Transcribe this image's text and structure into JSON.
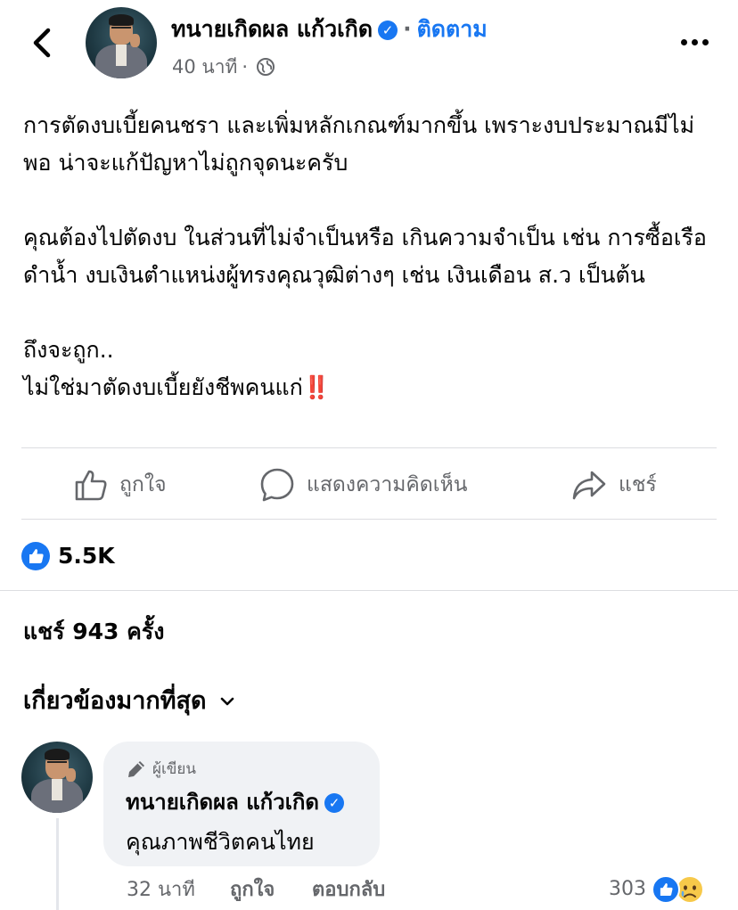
{
  "header": {
    "author_name": "ทนายเกิดผล แก้วเกิด",
    "follow_label": "ติดตาม",
    "time": "40 นาที",
    "separator": "·"
  },
  "post": {
    "paragraph_1": "การตัดงบเบี้ยคนชรา และเพิ่มหลักเกณฑ์มากขึ้น เพราะงบประมาณมีไม่พอ น่าจะแก้ปัญหาไม่ถูกจุดนะครับ",
    "paragraph_2": "คุณต้องไปตัดงบ ในส่วนที่ไม่จำเป็นหรือ เกินความจำเป็น เช่น การซื้อเรือดำน้ำ งบเงินตำแหน่งผู้ทรงคุณวุฒิต่างๆ เช่น เงินเดือน ส.ว เป็นต้น",
    "line_3": "ถึงจะถูก..",
    "line_4": "ไม่ใช่มาตัดงบเบี้ยยังชีพคนแก่",
    "emoji_4": "‼️"
  },
  "actions": {
    "like_label": "ถูกใจ",
    "comment_label": "แสดงความคิดเห็น",
    "share_label": "แชร์"
  },
  "stats": {
    "reaction_count": "5.5K",
    "shares_text": "แชร์ 943 ครั้ง"
  },
  "comments_filter": {
    "label": "เกี่ยวข้องมากที่สุด"
  },
  "comment": {
    "author_badge": "ผู้เขียน",
    "author_name": "ทนายเกิดผล แก้วเกิด",
    "text": "คุณภาพชีวิตคนไทย",
    "time": "32 นาที",
    "like_label": "ถูกใจ",
    "reply_label": "ตอบกลับ",
    "reaction_count": "303"
  },
  "colors": {
    "accent": "#1877f2",
    "muted_text": "#65676b",
    "bubble_bg": "#f0f2f5"
  },
  "icons": [
    "back-icon",
    "verified-icon",
    "globe-icon",
    "more-icon",
    "like-icon",
    "comment-icon",
    "share-icon",
    "like-reaction-icon",
    "chevron-down-icon",
    "pen-icon",
    "sad-reaction-icon"
  ]
}
